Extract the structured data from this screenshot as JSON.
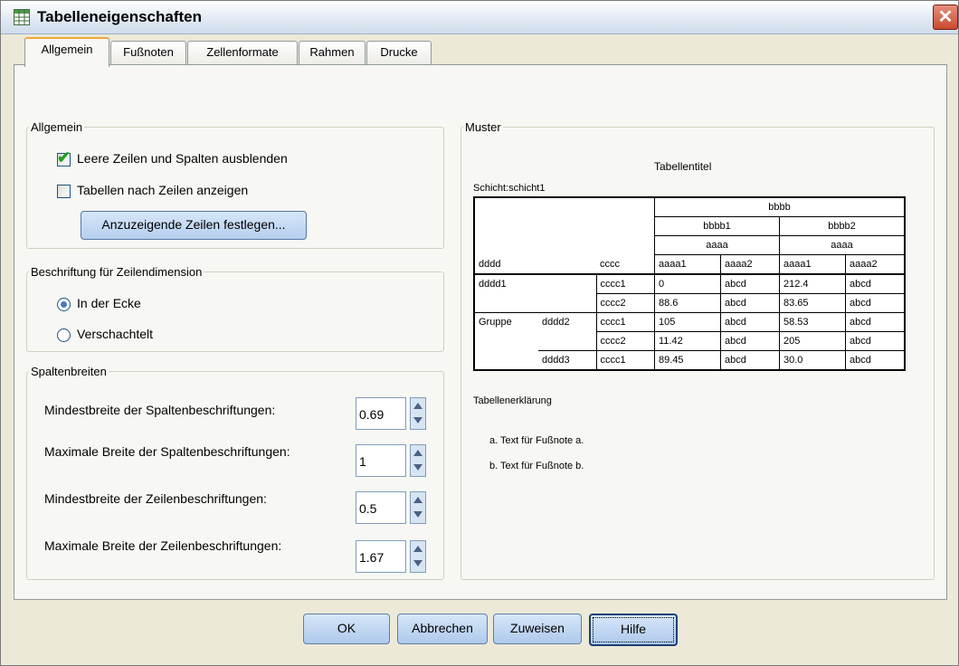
{
  "window": {
    "title": "Tabelleneigenschaften",
    "close_icon": "close-icon"
  },
  "tabs": [
    "Allgemein",
    "Fußnoten",
    "Zellenformate",
    "Rahmen",
    "Drucke"
  ],
  "general": {
    "legend": "Allgemein",
    "hide_empty": {
      "label": "Leere Zeilen und Spalten ausblenden",
      "checked": true
    },
    "by_rows": {
      "label": "Tabellen nach Zeilen anzeigen",
      "checked": false
    },
    "rows_button": "Anzuzeigende Zeilen festlegen..."
  },
  "row_dimension": {
    "legend": "Beschriftung für Zeilendimension",
    "corner": {
      "label": "In der Ecke",
      "selected": true
    },
    "nested": {
      "label": "Verschachtelt",
      "selected": false
    }
  },
  "column_widths": {
    "legend": "Spaltenbreiten",
    "fields": [
      {
        "label": "Mindestbreite der Spaltenbeschriftungen:",
        "value": "0.69"
      },
      {
        "label": "Maximale Breite der Spaltenbeschriftungen:",
        "value": "1"
      },
      {
        "label": "Mindestbreite der Zeilenbeschriftungen:",
        "value": "0.5"
      },
      {
        "label": "Maximale Breite der Zeilenbeschriftungen:",
        "value": "1.67"
      }
    ]
  },
  "sample": {
    "legend": "Muster",
    "table_title": "Tabellentitel",
    "layer": "Schicht:schicht1",
    "h_bbbb": "bbbb",
    "h_bbbb1": "bbbb1",
    "h_bbbb2": "bbbb2",
    "h_aaaa": "aaaa",
    "h_dddd": "dddd",
    "h_cccc": "cccc",
    "h_aaaa1": "aaaa1",
    "h_aaaa2": "aaaa2",
    "gruppe": "Gruppe",
    "rows": [
      {
        "d": "dddd1",
        "c": "cccc1",
        "v": [
          "0",
          "abcd",
          "212.4",
          "abcd"
        ]
      },
      {
        "d": "",
        "c": "cccc2",
        "v": [
          "88.6",
          "abcd",
          "83.65",
          "abcd"
        ]
      },
      {
        "d": "dddd2",
        "c": "cccc1",
        "v": [
          "105",
          "abcd",
          "58.53",
          "abcd"
        ]
      },
      {
        "d": "",
        "c": "cccc2",
        "v": [
          "11.42",
          "abcd",
          "205",
          "abcd"
        ]
      },
      {
        "d": "dddd3",
        "c": "cccc1",
        "v": [
          "89.45",
          "abcd",
          "30.0",
          "abcd"
        ]
      }
    ],
    "caption": "Tabellenerklärung",
    "footnote_a": "a. Text für Fußnote a.",
    "footnote_b": "b. Text für Fußnote b."
  },
  "buttons": {
    "ok": "OK",
    "cancel": "Abbrechen",
    "apply": "Zuweisen",
    "help": "Hilfe"
  }
}
